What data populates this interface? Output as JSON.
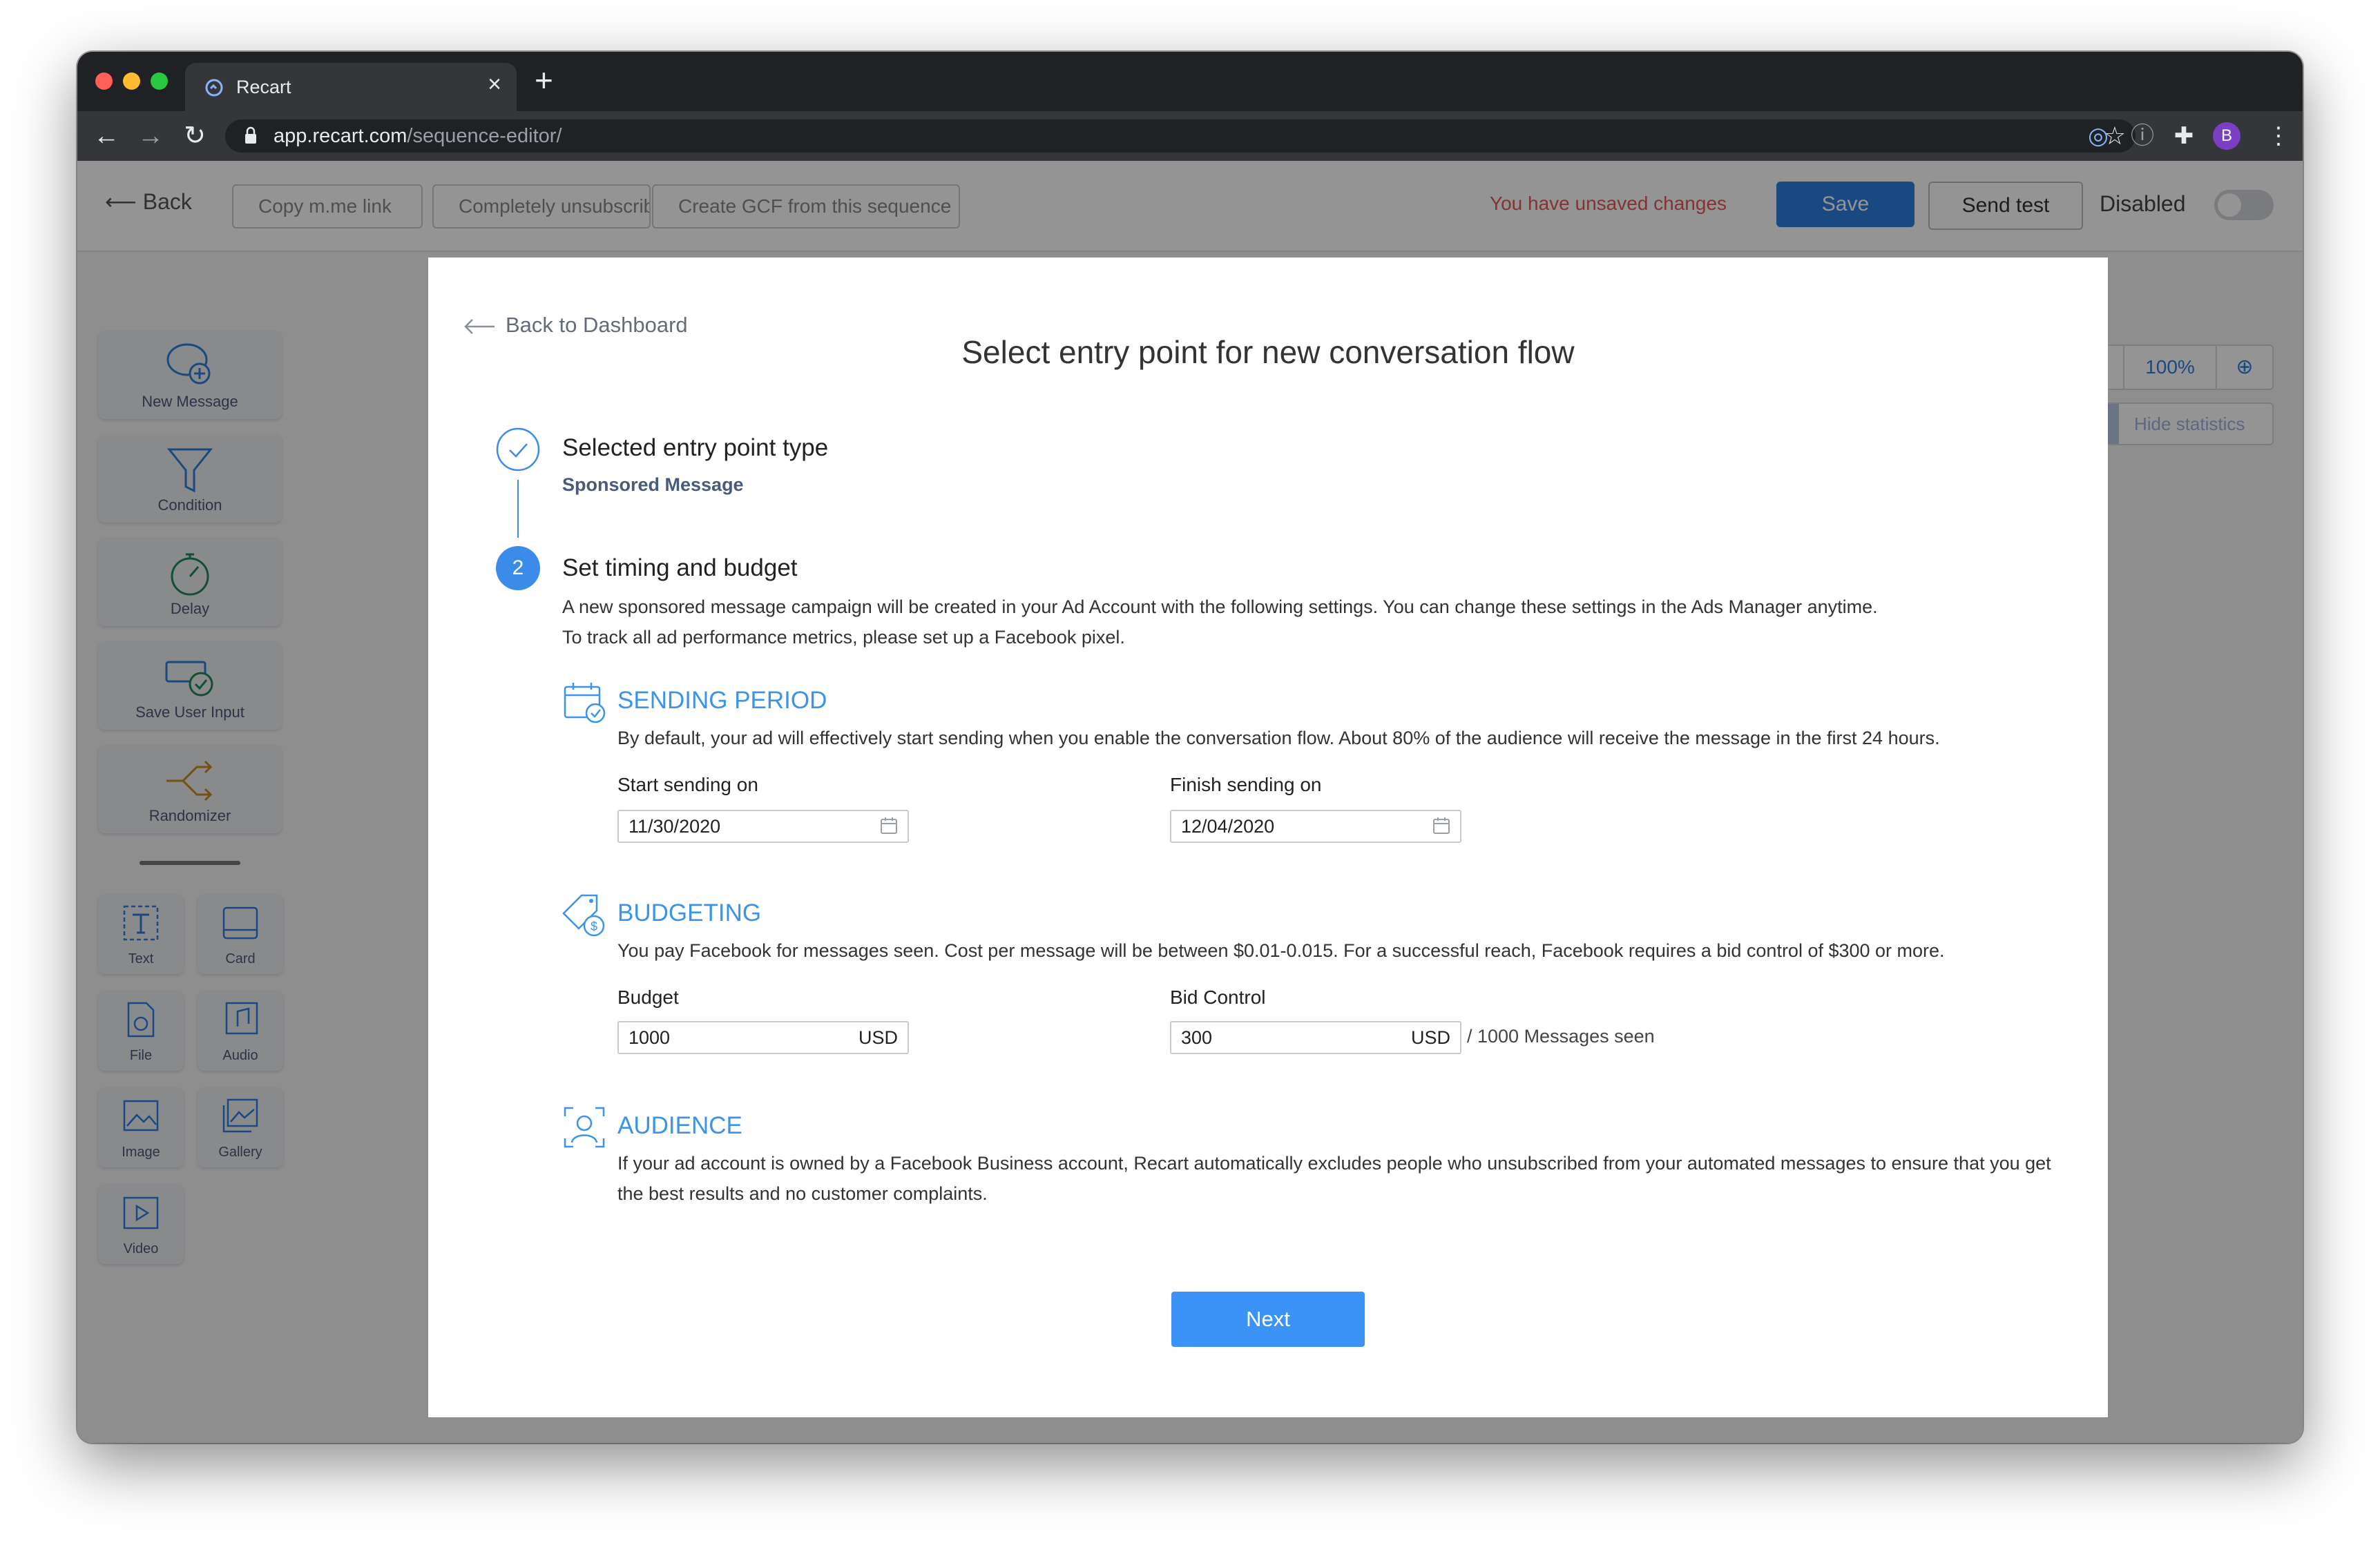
{
  "browser": {
    "tab_title": "Recart",
    "url_host": "app.recart.com",
    "url_path": "/sequence-editor/",
    "profile_initial": "B",
    "colors": {
      "close": "#ff5f57",
      "minimize": "#febc2e",
      "maximize": "#28c840"
    }
  },
  "app": {
    "back_label": "Back",
    "toolbar_buttons": [
      "Copy m.me link",
      "Completely unsubscribed users",
      "Create GCF from this sequence"
    ],
    "unsaved_warning": "You have unsaved changes",
    "save_label": "Save",
    "send_test_label": "Send test",
    "status_label": "Disabled",
    "zoom": {
      "out_icon": "zoom-out-icon",
      "value": "100%",
      "in_icon": "zoom-in-icon"
    },
    "hide_stats_label": "Hide statistics",
    "sidebar": {
      "large": [
        "New Message",
        "Condition",
        "Delay",
        "Save User Input",
        "Randomizer"
      ],
      "small": [
        "Text",
        "Card",
        "File",
        "Audio",
        "Image",
        "Gallery",
        "Video"
      ]
    }
  },
  "modal": {
    "back_link": "Back to Dashboard",
    "title": "Select entry point for new conversation flow",
    "step1": {
      "title": "Selected entry point type",
      "value": "Sponsored Message"
    },
    "step2": {
      "number": "2",
      "title": "Set timing and budget",
      "desc_line1": "A new sponsored message campaign will be created in your Ad Account with the following settings. You can change these settings in the Ads Manager anytime.",
      "desc_line2": "To track all ad performance metrics, please set up a Facebook pixel."
    },
    "sending_period": {
      "title": "SENDING PERIOD",
      "desc": "By default, your ad will effectively start sending when you enable the conversation flow. About 80% of the audience will receive the message in the first 24 hours.",
      "start_label": "Start sending on",
      "start_value": "11/30/2020",
      "finish_label": "Finish sending on",
      "finish_value": "12/04/2020"
    },
    "budgeting": {
      "title": "BUDGETING",
      "desc": "You pay Facebook for messages seen. Cost per message will be between $0.01-0.015. For a successful reach, Facebook requires a bid control of $300 or more.",
      "budget_label": "Budget",
      "budget_value": "1000",
      "budget_unit": "USD",
      "bid_label": "Bid Control",
      "bid_value": "300",
      "bid_unit": "USD",
      "bid_suffix": "/ 1000 Messages seen"
    },
    "audience": {
      "title": "AUDIENCE",
      "desc": "If your ad account is owned by a Facebook Business account, Recart automatically excludes people who unsubscribed from your automated messages to ensure that you get the best results and no customer complaints."
    },
    "next_label": "Next",
    "accent_color": "#3b94e8"
  }
}
